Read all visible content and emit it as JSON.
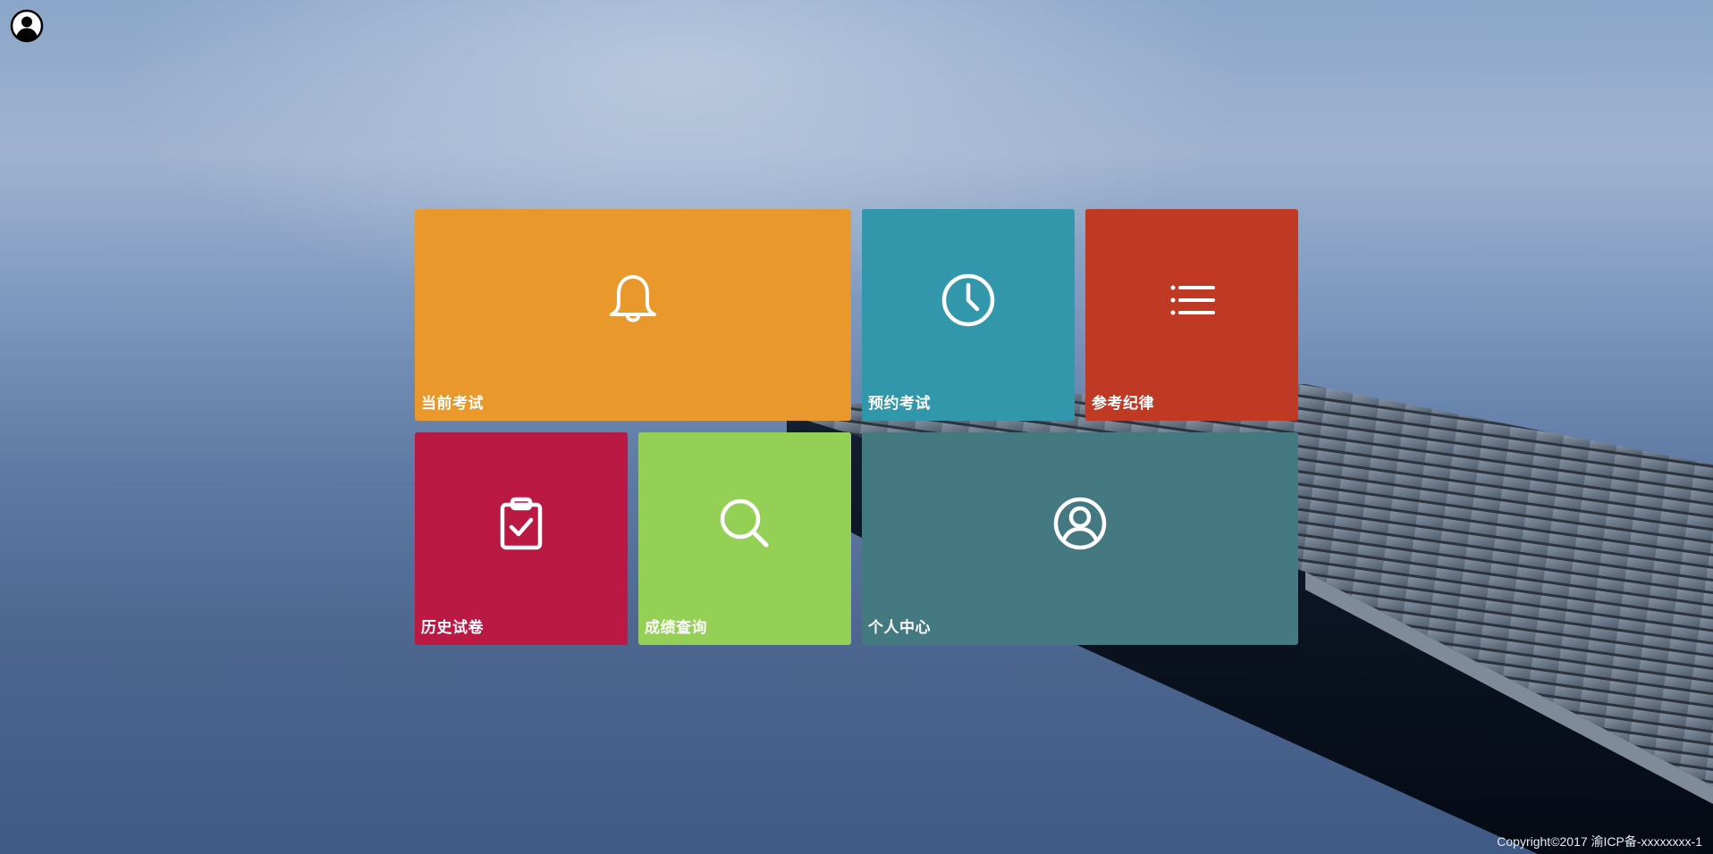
{
  "colors": {
    "current_exam": "#e9982b",
    "book_exam": "#3297aa",
    "exam_rules": "#bf3924",
    "history_papers": "#b91942",
    "score_query": "#93d055",
    "profile": "#457981"
  },
  "header": {
    "account_icon": "user-circle-icon"
  },
  "tiles": [
    {
      "key": "current_exam",
      "label": "当前考试",
      "icon": "bell-icon"
    },
    {
      "key": "book_exam",
      "label": "预约考试",
      "icon": "clock-icon"
    },
    {
      "key": "exam_rules",
      "label": "参考纪律",
      "icon": "list-icon"
    },
    {
      "key": "history_papers",
      "label": "历史试卷",
      "icon": "clipboard-check-icon"
    },
    {
      "key": "score_query",
      "label": "成绩查询",
      "icon": "search-icon"
    },
    {
      "key": "profile",
      "label": "个人中心",
      "icon": "user-circle-icon"
    }
  ],
  "footer": {
    "copyright": "Copyright©2017 渝ICP备-xxxxxxxx-1"
  }
}
